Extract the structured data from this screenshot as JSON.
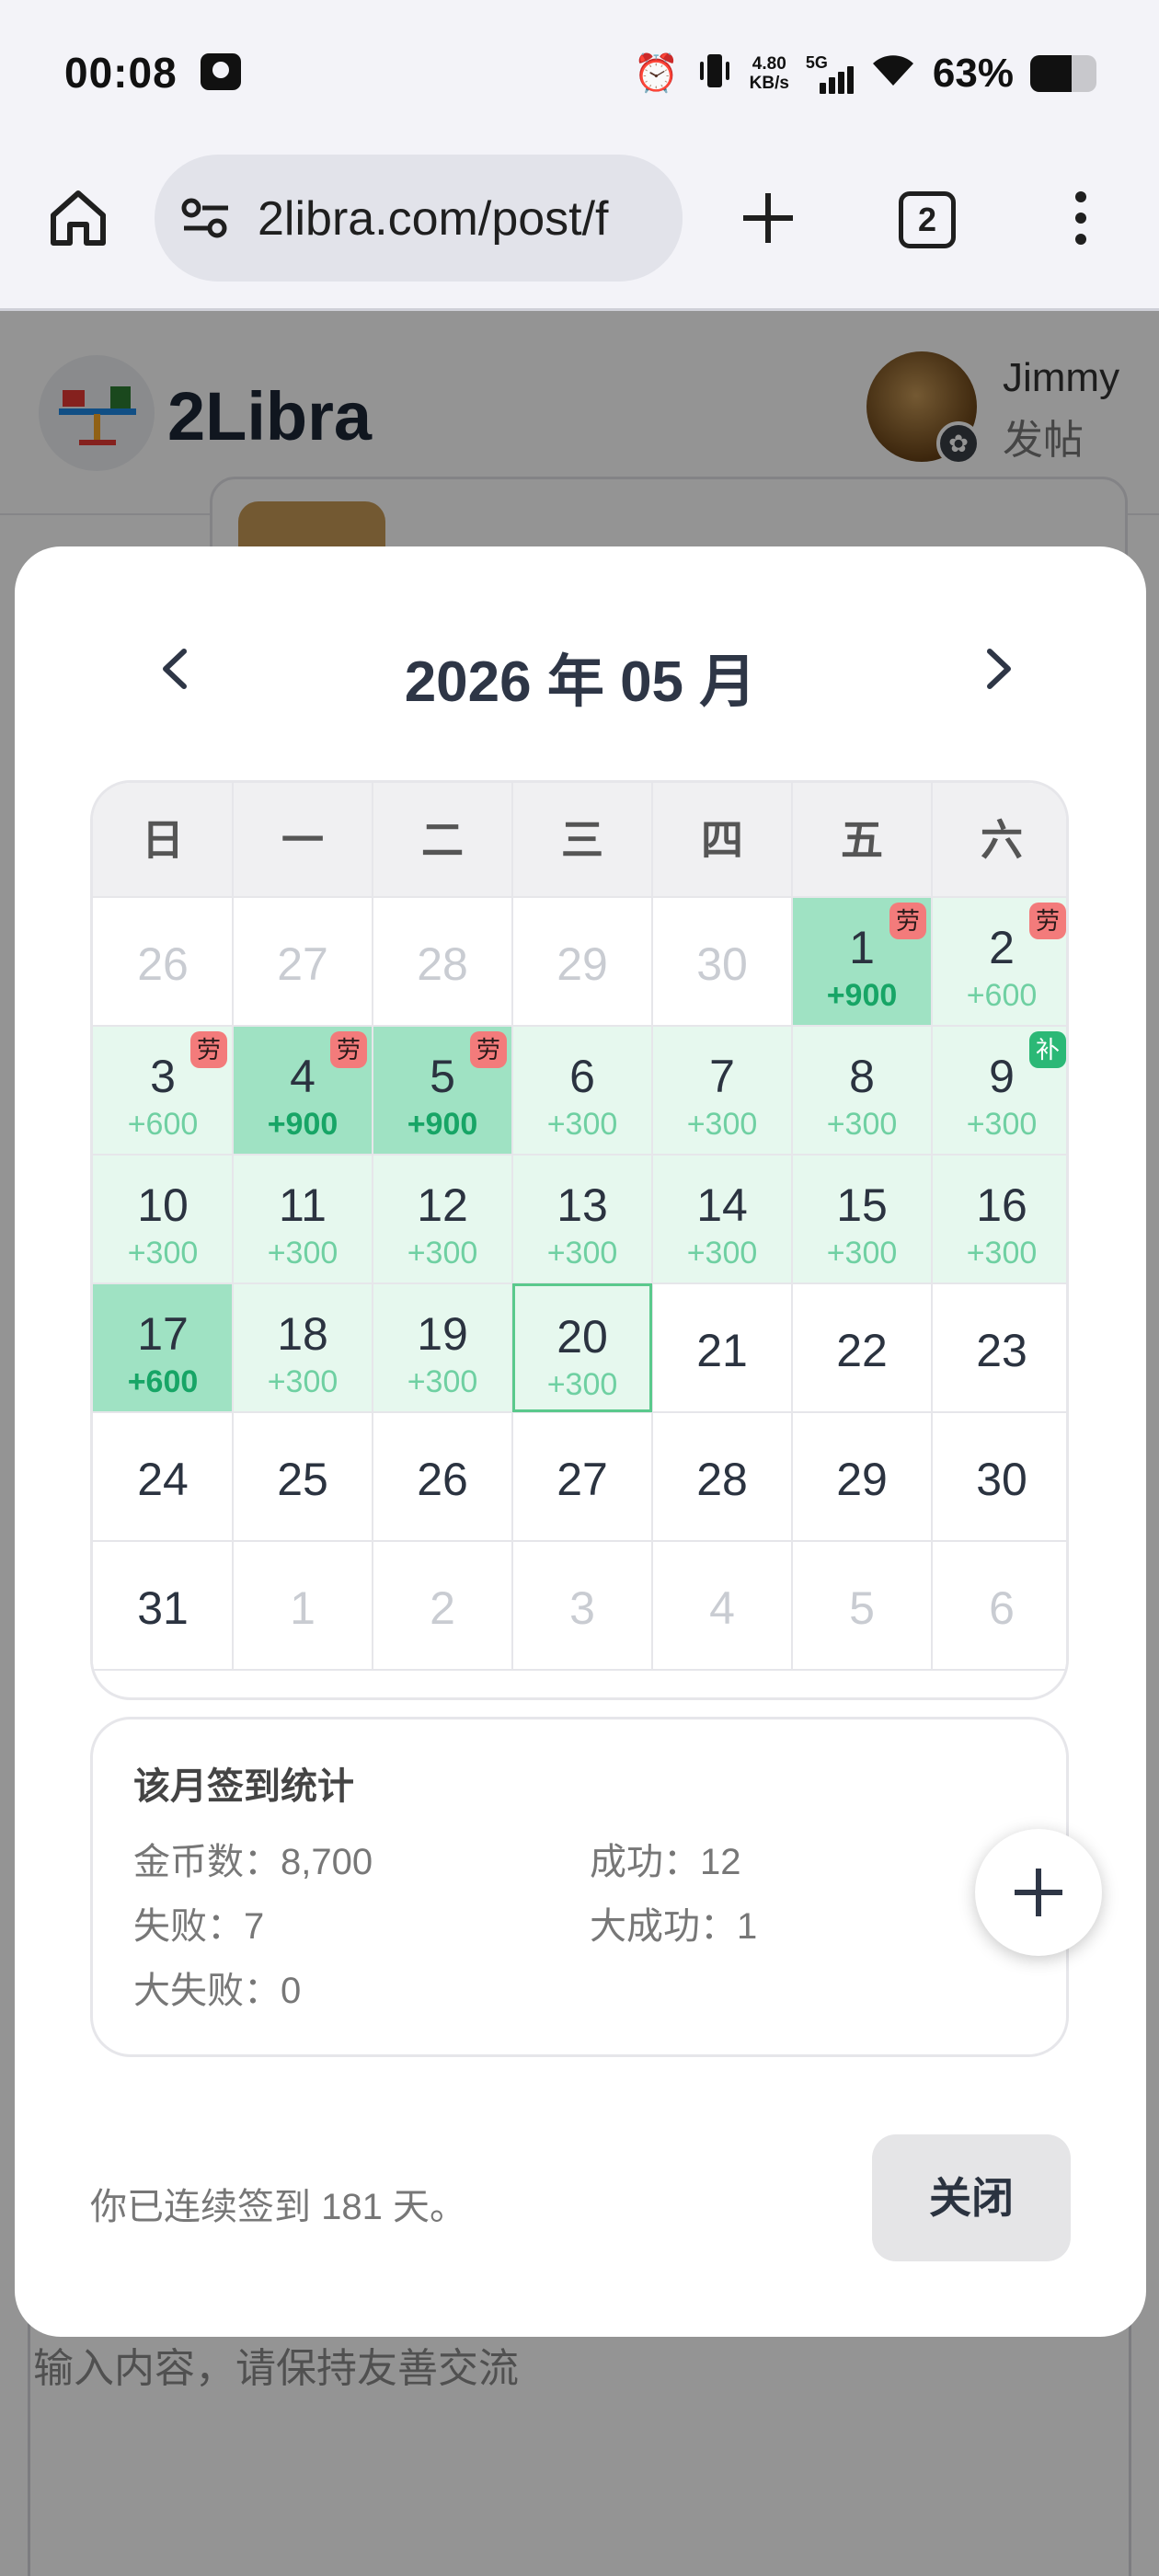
{
  "status_bar": {
    "time": "00:08",
    "net_speed_value": "4.80",
    "net_speed_unit": "KB/s",
    "network": "5G",
    "battery_pct": "63%",
    "battery_level": 0.63
  },
  "browser": {
    "url": "2libra.com/post/f",
    "tab_count": "2"
  },
  "site": {
    "name": "2Libra",
    "user_name": "Jimmy",
    "post_label": "发帖",
    "comment_placeholder": "输入内容，请保持友善交流"
  },
  "calendar": {
    "title": "2026 年 05 月",
    "weekdays": [
      "日",
      "一",
      "二",
      "三",
      "四",
      "五",
      "六"
    ],
    "days": [
      {
        "d": "26",
        "s": "faded"
      },
      {
        "d": "27",
        "s": "faded"
      },
      {
        "d": "28",
        "s": "faded"
      },
      {
        "d": "29",
        "s": "faded"
      },
      {
        "d": "30",
        "s": "faded"
      },
      {
        "d": "1",
        "s": "bonus",
        "p": "+900",
        "b": "劳"
      },
      {
        "d": "2",
        "s": "normal",
        "p": "+600",
        "b": "劳"
      },
      {
        "d": "3",
        "s": "normal",
        "p": "+600",
        "b": "劳"
      },
      {
        "d": "4",
        "s": "bonus",
        "p": "+900",
        "b": "劳"
      },
      {
        "d": "5",
        "s": "bonus",
        "p": "+900",
        "b": "劳"
      },
      {
        "d": "6",
        "s": "normal",
        "p": "+300"
      },
      {
        "d": "7",
        "s": "normal",
        "p": "+300"
      },
      {
        "d": "8",
        "s": "normal",
        "p": "+300"
      },
      {
        "d": "9",
        "s": "normal",
        "p": "+300",
        "b": "补"
      },
      {
        "d": "10",
        "s": "normal",
        "p": "+300"
      },
      {
        "d": "11",
        "s": "normal",
        "p": "+300"
      },
      {
        "d": "12",
        "s": "normal",
        "p": "+300"
      },
      {
        "d": "13",
        "s": "normal",
        "p": "+300"
      },
      {
        "d": "14",
        "s": "normal",
        "p": "+300"
      },
      {
        "d": "15",
        "s": "normal",
        "p": "+300"
      },
      {
        "d": "16",
        "s": "normal",
        "p": "+300"
      },
      {
        "d": "17",
        "s": "bonus",
        "p": "+600"
      },
      {
        "d": "18",
        "s": "normal",
        "p": "+300"
      },
      {
        "d": "19",
        "s": "normal",
        "p": "+300"
      },
      {
        "d": "20",
        "s": "normal",
        "p": "+300",
        "today": true
      },
      {
        "d": "21",
        "s": "plain"
      },
      {
        "d": "22",
        "s": "plain"
      },
      {
        "d": "23",
        "s": "plain"
      },
      {
        "d": "24",
        "s": "plain"
      },
      {
        "d": "25",
        "s": "plain"
      },
      {
        "d": "26",
        "s": "plain"
      },
      {
        "d": "27",
        "s": "plain"
      },
      {
        "d": "28",
        "s": "plain"
      },
      {
        "d": "29",
        "s": "plain"
      },
      {
        "d": "30",
        "s": "plain"
      },
      {
        "d": "31",
        "s": "plain"
      },
      {
        "d": "1",
        "s": "faded"
      },
      {
        "d": "2",
        "s": "faded"
      },
      {
        "d": "3",
        "s": "faded"
      },
      {
        "d": "4",
        "s": "faded"
      },
      {
        "d": "5",
        "s": "faded"
      },
      {
        "d": "6",
        "s": "faded"
      }
    ]
  },
  "stats": {
    "title": "该月签到统计",
    "coins": "金币数：8,700",
    "success": "成功：12",
    "fail": "失败：7",
    "big_success": "大成功：1",
    "big_fail": "大失败：0"
  },
  "footer": {
    "streak": "你已连续签到 181 天。",
    "close_label": "关闭"
  },
  "colors": {
    "signed": "#e6f8ee",
    "bonus": "#9fe2c3",
    "points": "#6fd0a2",
    "badge_lao": "#f37b7b",
    "badge_bu": "#2bb876"
  }
}
